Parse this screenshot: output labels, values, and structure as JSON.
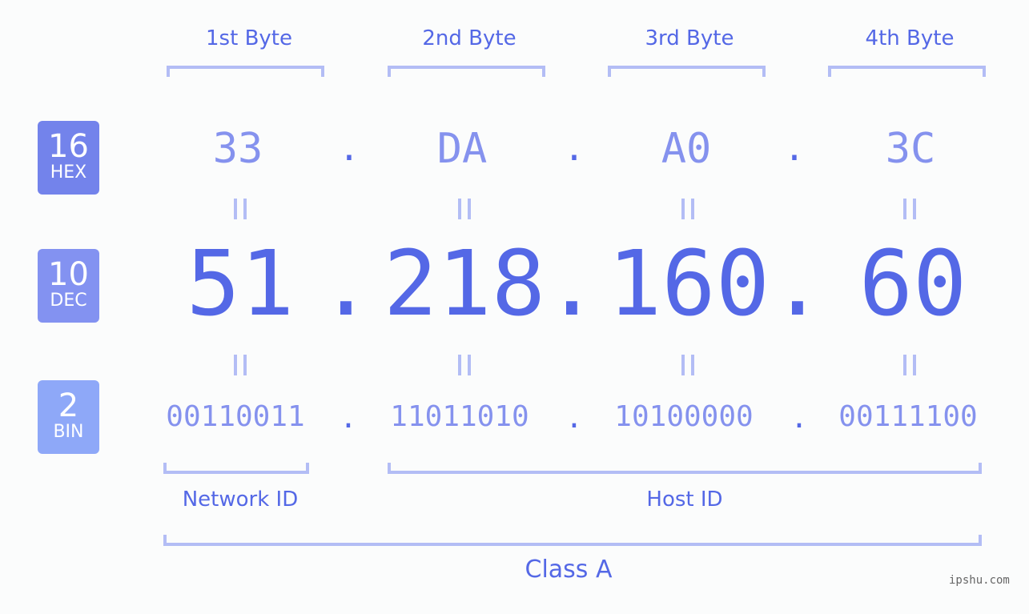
{
  "bytes": [
    {
      "label": "1st Byte",
      "hex": "33",
      "dec": "51",
      "bin": "00110011"
    },
    {
      "label": "2nd Byte",
      "hex": "DA",
      "dec": "218",
      "bin": "11011010"
    },
    {
      "label": "3rd Byte",
      "hex": "A0",
      "dec": "160",
      "bin": "10100000"
    },
    {
      "label": "4th Byte",
      "hex": "3C",
      "dec": "60",
      "bin": "00111100"
    }
  ],
  "separator": ".",
  "badges": {
    "hex": {
      "num": "16",
      "label": "HEX",
      "color": "#7383eb"
    },
    "dec": {
      "num": "10",
      "label": "DEC",
      "color": "#8392f1"
    },
    "bin": {
      "num": "2",
      "label": "BIN",
      "color": "#8ea8f8"
    }
  },
  "sections": {
    "network": "Network ID",
    "host": "Host ID",
    "class": "Class A"
  },
  "watermark": "ipshu.com",
  "colors": {
    "accent": "#5468e6",
    "muted": "#8592ee",
    "bracket": "#b3bdf5"
  }
}
